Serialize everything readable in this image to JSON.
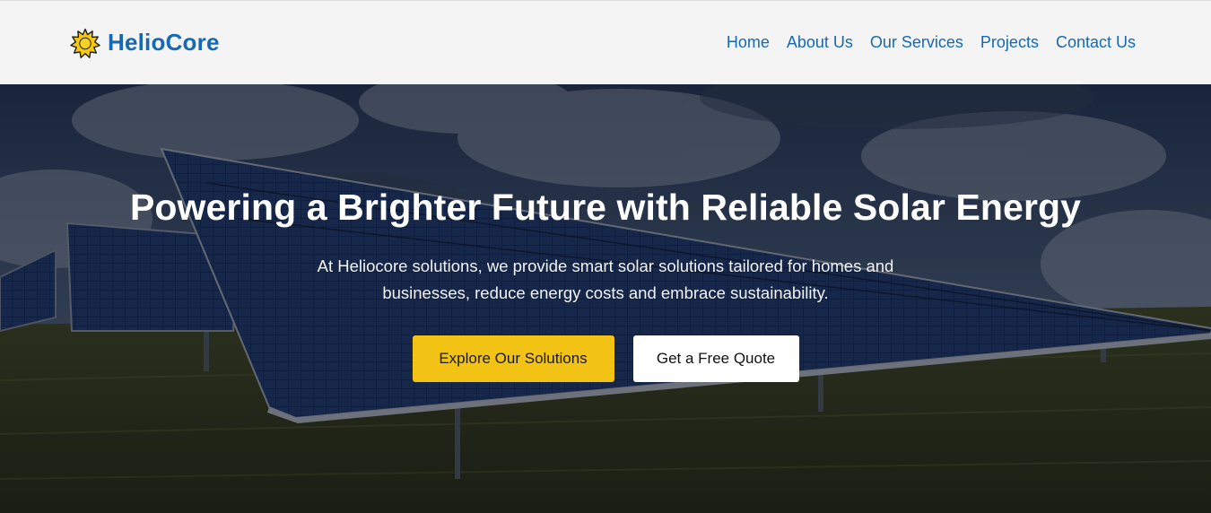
{
  "header": {
    "brand": {
      "name": "HelioCore",
      "logo_icon": "sun-icon"
    },
    "nav": [
      {
        "label": "Home"
      },
      {
        "label": "About Us"
      },
      {
        "label": "Our Services"
      },
      {
        "label": "Projects"
      },
      {
        "label": "Contact Us"
      }
    ]
  },
  "hero": {
    "title": "Powering a Brighter Future with Reliable Solar Energy",
    "subtitle": "At Heliocore solutions, we provide smart solar solutions tailored for homes and businesses, reduce energy costs and embrace sustainability.",
    "buttons": {
      "primary": "Explore Our Solutions",
      "secondary": "Get a Free Quote"
    }
  },
  "colors": {
    "brand_blue": "#1769b3",
    "accent_yellow": "#f2c214",
    "nav_background": "#f4f4f4",
    "text_on_hero": "#ffffff"
  }
}
